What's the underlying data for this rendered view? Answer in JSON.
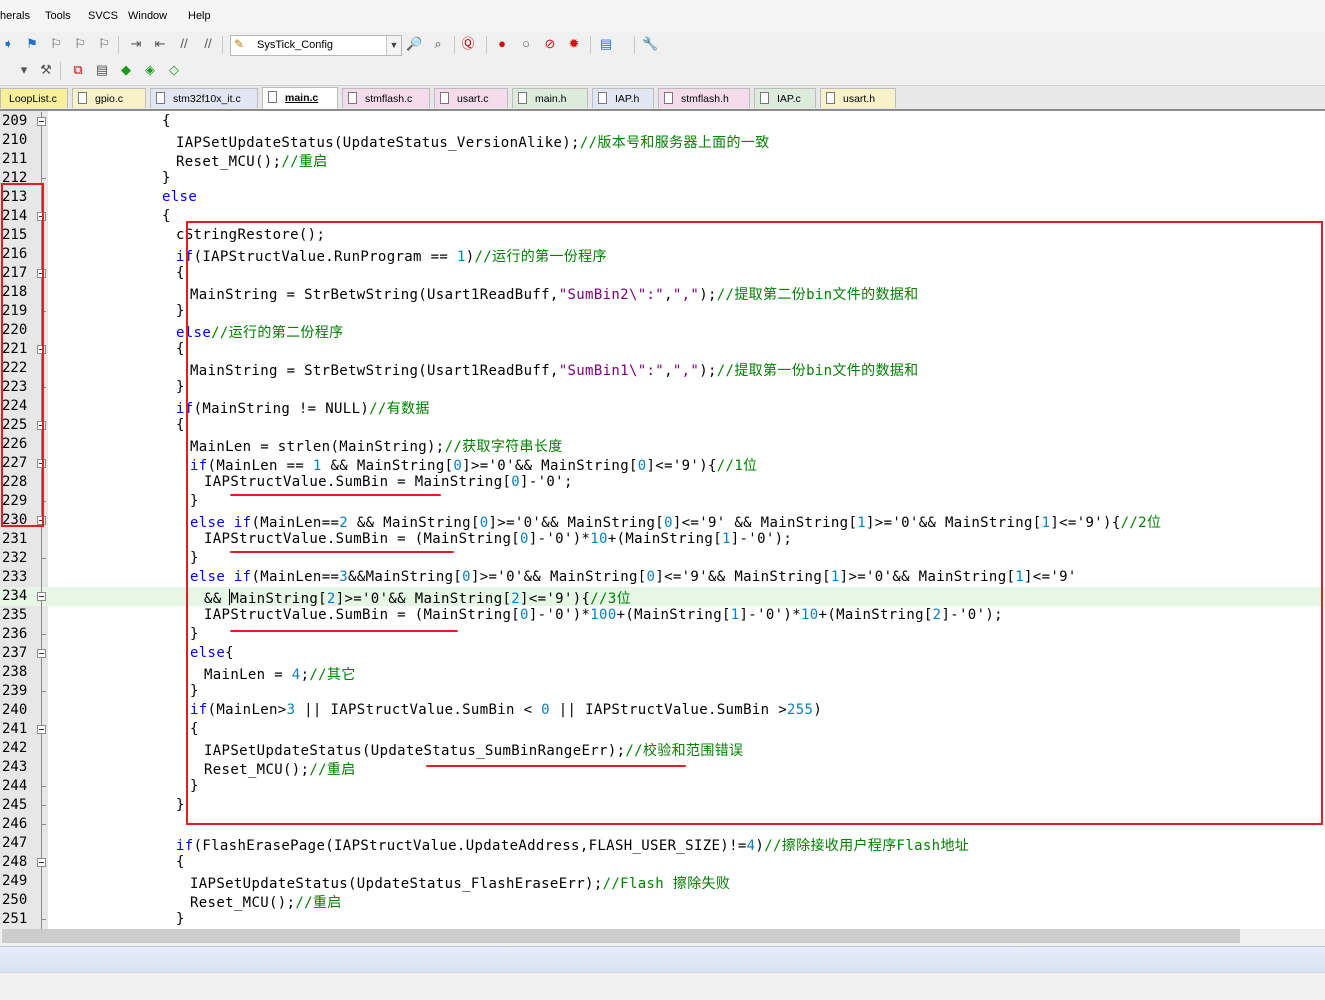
{
  "menu": [
    "herals",
    "Tools",
    "SVCS",
    "Window",
    "Help"
  ],
  "toolbar": {
    "target_name": "SysTick_Config",
    "icons": [
      "nav-forward-icon",
      "bookmark-icon",
      "bookmark-prev-icon",
      "bookmark-next-icon",
      "bookmark-clear-icon",
      "indent-icon",
      "unindent-icon",
      "comment-icon",
      "uncomment-icon",
      "find-in-files-icon",
      "incremental-find-icon",
      "debug-session-icon",
      "breakpoint-insert-icon",
      "breakpoint-enable-icon",
      "breakpoint-disable-icon",
      "breakpoint-kill-icon",
      "window-layout-icon",
      "configure-icon"
    ],
    "icons2": [
      "target-select-icon",
      "options-for-target-icon",
      "manage-project-icon",
      "file-extensions-icon",
      "green-diamond-icon",
      "pack-installer-icon",
      "software-packs-icon"
    ]
  },
  "tabs": [
    {
      "label": "LoopList.c",
      "color": "yellow"
    },
    {
      "label": "gpio.c",
      "color": "ltyellow"
    },
    {
      "label": "stm32f10x_it.c",
      "color": "blue"
    },
    {
      "label": "main.c",
      "color": "active"
    },
    {
      "label": "stmflash.c",
      "color": "pink"
    },
    {
      "label": "usart.c",
      "color": "pink"
    },
    {
      "label": "main.h",
      "color": "green"
    },
    {
      "label": "IAP.h",
      "color": "blue"
    },
    {
      "label": "stmflash.h",
      "color": "pink"
    },
    {
      "label": "IAP.c",
      "color": "green"
    },
    {
      "label": "usart.h",
      "color": "ltyellow"
    }
  ],
  "code_lines": [
    {
      "n": "209",
      "t": "        {"
    },
    {
      "n": "210",
      "t": "         IAPSetUpdateStatus(UpdateStatus_VersionAlike);//版本号和服务器上面的一致"
    },
    {
      "n": "211",
      "t": "         Reset_MCU();//重启"
    },
    {
      "n": "212",
      "t": "        }"
    },
    {
      "n": "213",
      "t": "        else"
    },
    {
      "n": "214",
      "t": "        {"
    },
    {
      "n": "215",
      "t": "         cStringRestore();"
    },
    {
      "n": "216",
      "t": "         if(IAPStructValue.RunProgram == 1)//运行的第一份程序"
    },
    {
      "n": "217",
      "t": "         {"
    },
    {
      "n": "218",
      "t": "          MainString = StrBetwString(Usart1ReadBuff,\"SumBin2\\\":\",\",\");//提取第二份bin文件的数据和"
    },
    {
      "n": "219",
      "t": "         }"
    },
    {
      "n": "220",
      "t": "         else//运行的第二份程序"
    },
    {
      "n": "221",
      "t": "         {"
    },
    {
      "n": "222",
      "t": "          MainString = StrBetwString(Usart1ReadBuff,\"SumBin1\\\":\",\",\");//提取第一份bin文件的数据和"
    },
    {
      "n": "223",
      "t": "         }"
    },
    {
      "n": "224",
      "t": "         if(MainString != NULL)//有数据"
    },
    {
      "n": "225",
      "t": "         {"
    },
    {
      "n": "226",
      "t": "          MainLen = strlen(MainString);//获取字符串长度"
    },
    {
      "n": "227",
      "t": "          if(MainLen == 1 && MainString[0]>='0'&& MainString[0]<='9'){//1位"
    },
    {
      "n": "228",
      "t": "           IAPStructValue.SumBin = MainString[0]-'0';"
    },
    {
      "n": "229",
      "t": "          }"
    },
    {
      "n": "230",
      "t": "          else if(MainLen==2 && MainString[0]>='0'&& MainString[0]<='9' && MainString[1]>='0'&& MainString[1]<='9'){//2位"
    },
    {
      "n": "231",
      "t": "           IAPStructValue.SumBin = (MainString[0]-'0')*10+(MainString[1]-'0');"
    },
    {
      "n": "232",
      "t": "          }"
    },
    {
      "n": "233",
      "t": "          else if(MainLen==3&&MainString[0]>='0'&& MainString[0]<='9'&& MainString[1]>='0'&& MainString[1]<='9'"
    },
    {
      "n": "234",
      "t": "           && MainString[2]>='0'&& MainString[2]<='9'){//3位"
    },
    {
      "n": "235",
      "t": "           IAPStructValue.SumBin = (MainString[0]-'0')*100+(MainString[1]-'0')*10+(MainString[2]-'0');"
    },
    {
      "n": "236",
      "t": "          }"
    },
    {
      "n": "237",
      "t": "          else{"
    },
    {
      "n": "238",
      "t": "           MainLen = 4;//其它"
    },
    {
      "n": "239",
      "t": "          }"
    },
    {
      "n": "240",
      "t": "          if(MainLen>3 || IAPStructValue.SumBin < 0 || IAPStructValue.SumBin >255)"
    },
    {
      "n": "241",
      "t": "          {"
    },
    {
      "n": "242",
      "t": "           IAPSetUpdateStatus(UpdateStatus_SumBinRangeErr);//校验和范围错误"
    },
    {
      "n": "243",
      "t": "           Reset_MCU();//重启"
    },
    {
      "n": "244",
      "t": "          }"
    },
    {
      "n": "245",
      "t": "         }"
    },
    {
      "n": "246",
      "t": ""
    },
    {
      "n": "247",
      "t": "         if(FlashErasePage(IAPStructValue.UpdateAddress,FLASH_USER_SIZE)!=4)//擦除接收用户程序Flash地址"
    },
    {
      "n": "248",
      "t": "         {"
    },
    {
      "n": "249",
      "t": "          IAPSetUpdateStatus(UpdateStatus_FlashEraseErr);//Flash 擦除失败"
    },
    {
      "n": "250",
      "t": "          Reset_MCU();//重启"
    },
    {
      "n": "251",
      "t": "         }"
    }
  ],
  "current_line": "234",
  "colors": {
    "keyword": "#0000ff",
    "comment": "#008000",
    "string": "#800080",
    "number": "#0a7fbf",
    "annotation": "#e02020",
    "current_line_bg": "#e6f7e6"
  }
}
